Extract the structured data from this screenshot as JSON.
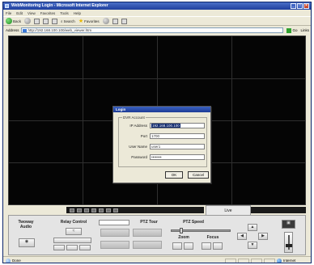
{
  "window": {
    "title": "WebMonitoring Login - Microsoft Internet Explorer"
  },
  "menu": {
    "items": [
      "File",
      "Edit",
      "View",
      "Favorites",
      "Tools",
      "Help"
    ]
  },
  "toolbar": {
    "back_label": "Back",
    "search_label": "Search",
    "favorites_label": "Favorites"
  },
  "address": {
    "label": "Address",
    "url": "http://192.168.100.100/web_viewer.htm",
    "go_label": "Go",
    "links_label": "Links"
  },
  "login_dialog": {
    "title": "Login",
    "group_label": "DVR Account",
    "ip_label": "IP Address",
    "ip_value": "192.168.100.100",
    "port_label": "Port",
    "port_value": "1700",
    "user_label": "User Name",
    "user_value": "user1",
    "password_label": "Password",
    "password_value": "••••••••",
    "ok_label": "OK",
    "cancel_label": "Cancel"
  },
  "viewer": {
    "live_tab": "Live"
  },
  "panel": {
    "twoway_label": "Twoway Audio",
    "relay_label": "Relay Control",
    "ptz_tour_label": "PTZ Tour",
    "ptz_speed_label": "PTZ Speed",
    "zoom_label": "Zoom",
    "focus_label": "Focus",
    "ptz_speed_level": 0.15
  },
  "status": {
    "left": "Done",
    "zone": "Internet"
  }
}
